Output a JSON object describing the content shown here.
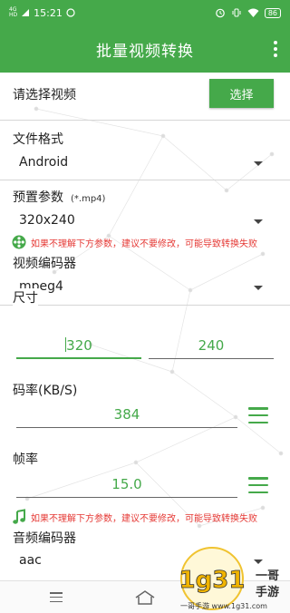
{
  "status_bar": {
    "network": "4G",
    "signal_label": "HD",
    "time": "15:21",
    "battery": "86"
  },
  "app_bar": {
    "title": "批量视频转换"
  },
  "select_video": {
    "label": "请选择视频",
    "button": "选择"
  },
  "file_format": {
    "label": "文件格式",
    "value": "Android"
  },
  "preset": {
    "label": "预置参数",
    "hint": "(*.mp4)",
    "value": "320x240"
  },
  "video_warning": "如果不理解下方参数，建议不要修改，可能导致转换失败",
  "video_codec": {
    "label": "视频编码器",
    "value": "mpeg4"
  },
  "size": {
    "label": "尺寸",
    "width": "320",
    "height": "240"
  },
  "bitrate": {
    "label": "码率(KB/S)",
    "value": "384"
  },
  "framerate": {
    "label": "帧率",
    "value": "15.0"
  },
  "audio_warning": "如果不理解下方参数，建议不要修改，可能导致转换失败",
  "audio_codec": {
    "label": "音频编码器",
    "value": "aac"
  },
  "watermark": {
    "brand_top": "一哥",
    "brand_bottom": "手游",
    "url": "一哥手游 www.1g31.com",
    "logo": "1g31"
  },
  "colors": {
    "accent": "#45a94a",
    "warning": "#e53935"
  }
}
